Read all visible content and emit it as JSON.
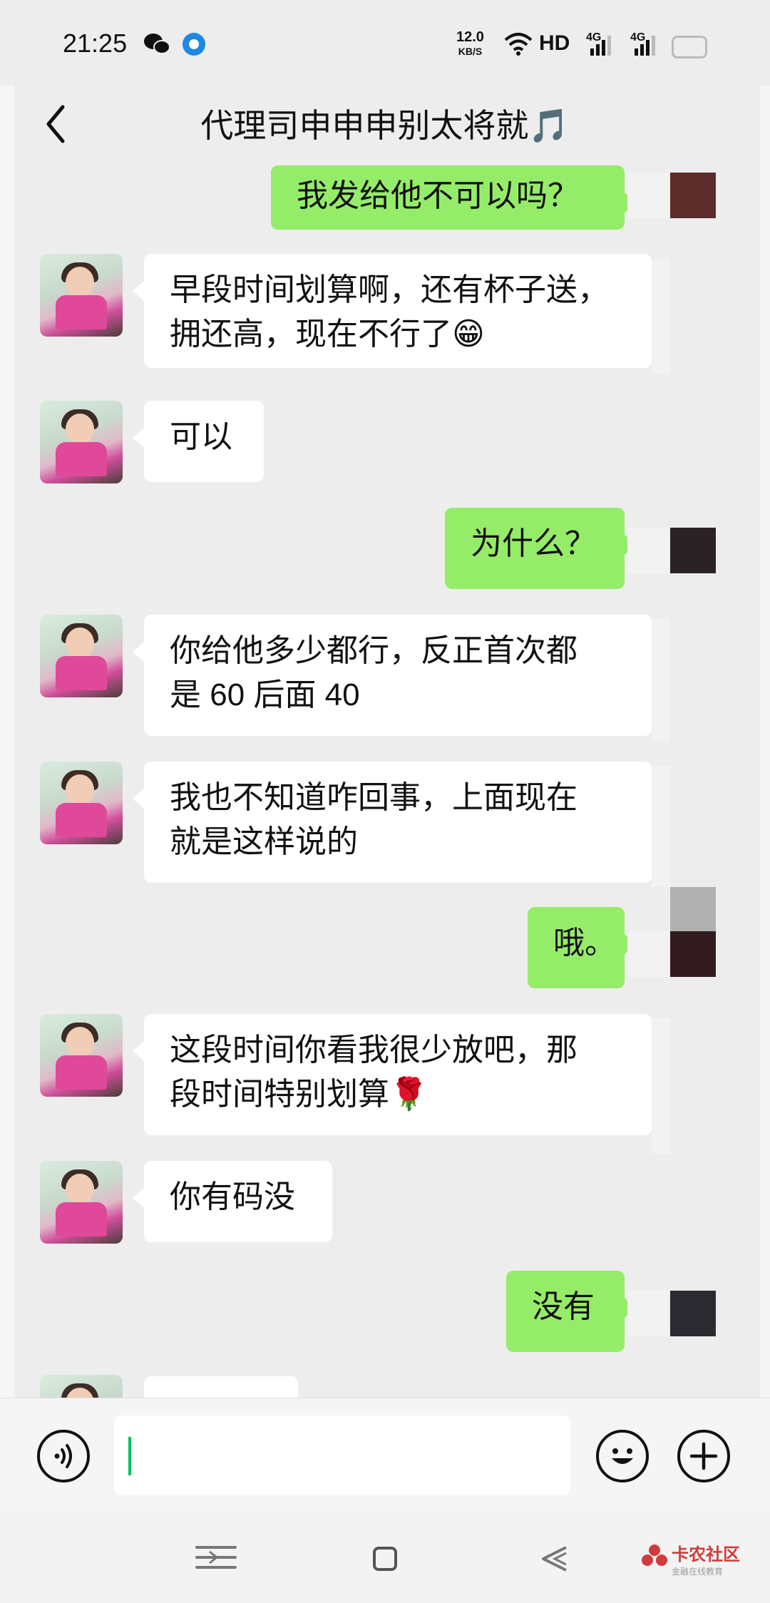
{
  "status_bar": {
    "time": "21:25",
    "net_speed_value": "12.0",
    "net_speed_unit": "KB/S",
    "hd_label": "HD",
    "sig1_label": "4G",
    "sig2_label": "4G"
  },
  "header": {
    "title": "代理司申申申别太将就🎵"
  },
  "messages": [
    {
      "side": "out",
      "text": "我发给他不可以吗？"
    },
    {
      "side": "in",
      "lines": [
        "早段时间划算啊，还有杯子送，",
        "拥还高，现在不行了😁"
      ]
    },
    {
      "side": "in",
      "text": "可以"
    },
    {
      "side": "out",
      "text": "为什么？"
    },
    {
      "side": "in",
      "lines": [
        "你给他多少都行，反正首次都",
        "是 60 后面 40"
      ]
    },
    {
      "side": "in",
      "lines": [
        "我也不知道咋回事，上面现在",
        "就是这样说的"
      ]
    },
    {
      "side": "out",
      "text": "哦。"
    },
    {
      "side": "in",
      "lines": [
        "这段时间你看我很少放吧，那",
        "段时间特别划算🌹"
      ]
    },
    {
      "side": "in",
      "text": "你有码没"
    },
    {
      "side": "out",
      "text": "没有"
    }
  ],
  "input_bar": {
    "voice_icon": "voice-icon",
    "emoji_icon": "emoji-icon",
    "plus_icon": "plus-icon"
  },
  "watermark": {
    "brand": "卡农社区",
    "tagline": "金融在线教育"
  }
}
